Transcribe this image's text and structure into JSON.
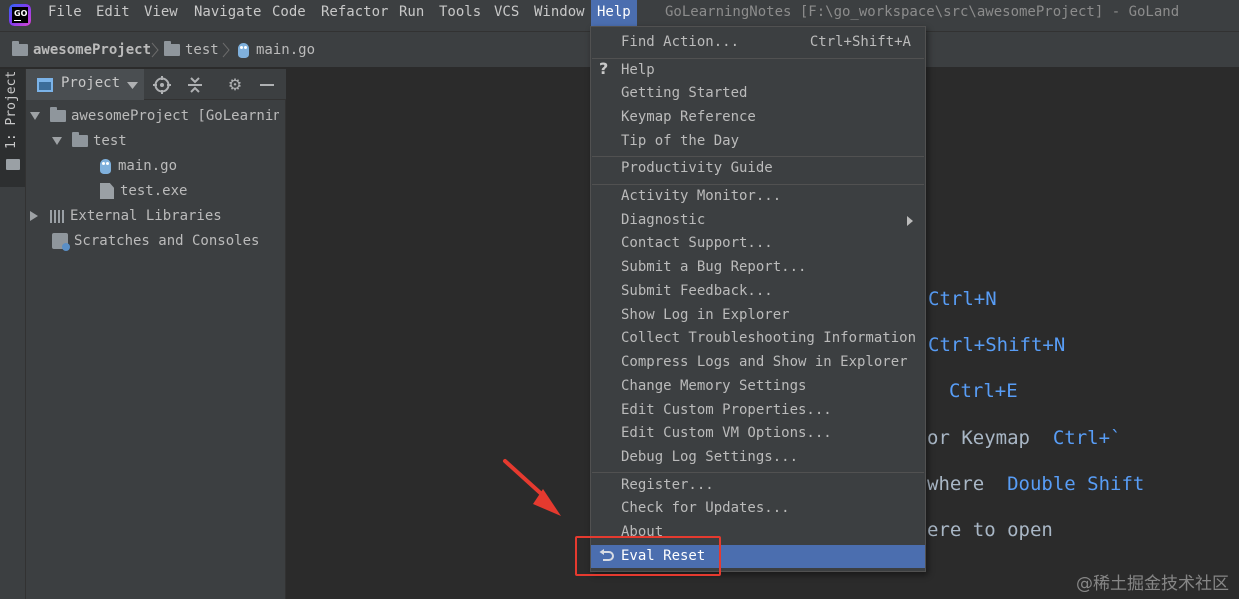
{
  "menubar": {
    "items": [
      {
        "label": "File"
      },
      {
        "label": "Edit"
      },
      {
        "label": "View"
      },
      {
        "label": "Navigate"
      },
      {
        "label": "Code"
      },
      {
        "label": "Refactor"
      },
      {
        "label": "Run"
      },
      {
        "label": "Tools"
      },
      {
        "label": "VCS"
      },
      {
        "label": "Window"
      },
      {
        "label": "Help"
      }
    ],
    "active": "Help",
    "window_title": "GoLearningNotes [F:\\go_workspace\\src\\awesomeProject] - GoLand",
    "logo_text": "GO"
  },
  "breadcrumb": {
    "items": [
      "awesomeProject",
      "test",
      "main.go"
    ]
  },
  "tool_stripe": {
    "label": "1: Project"
  },
  "project_panel": {
    "title": "Project",
    "tree": [
      {
        "label": "awesomeProject [GoLearningNotes]"
      },
      {
        "label": "test"
      },
      {
        "label": "main.go"
      },
      {
        "label": "test.exe"
      },
      {
        "label": "External Libraries"
      },
      {
        "label": "Scratches and Consoles"
      }
    ]
  },
  "editor_hints": [
    {
      "text": "",
      "key": "Ctrl+N"
    },
    {
      "text": "",
      "key": "Ctrl+Shift+N"
    },
    {
      "text": "",
      "key": "Ctrl+E"
    },
    {
      "text": "or Keymap",
      "key": "Ctrl+`"
    },
    {
      "text": "where",
      "key": "Double Shift"
    },
    {
      "text": "ere to open",
      "key": ""
    }
  ],
  "help_menu": {
    "find_action": {
      "label": "Find Action...",
      "shortcut": "Ctrl+Shift+A"
    },
    "items": [
      {
        "label": "Help"
      },
      {
        "label": "Getting Started"
      },
      {
        "label": "Keymap Reference"
      },
      {
        "label": "Tip of the Day"
      },
      {
        "label": "Productivity Guide"
      },
      {
        "label": "Activity Monitor..."
      },
      {
        "label": "Diagnostic"
      },
      {
        "label": "Contact Support..."
      },
      {
        "label": "Submit a Bug Report..."
      },
      {
        "label": "Submit Feedback..."
      },
      {
        "label": "Show Log in Explorer"
      },
      {
        "label": "Collect Troubleshooting Information"
      },
      {
        "label": "Compress Logs and Show in Explorer"
      },
      {
        "label": "Change Memory Settings"
      },
      {
        "label": "Edit Custom Properties..."
      },
      {
        "label": "Edit Custom VM Options..."
      },
      {
        "label": "Debug Log Settings..."
      },
      {
        "label": "Register..."
      },
      {
        "label": "Check for Updates..."
      },
      {
        "label": "About"
      },
      {
        "label": "Eval Reset"
      }
    ],
    "selected": "Eval Reset"
  },
  "watermark": "@稀土掘金技术社区",
  "colors": {
    "accent_selection": "#4b6eaf",
    "annotation_red": "#e53a2f",
    "shortcut_blue": "#589df6"
  }
}
